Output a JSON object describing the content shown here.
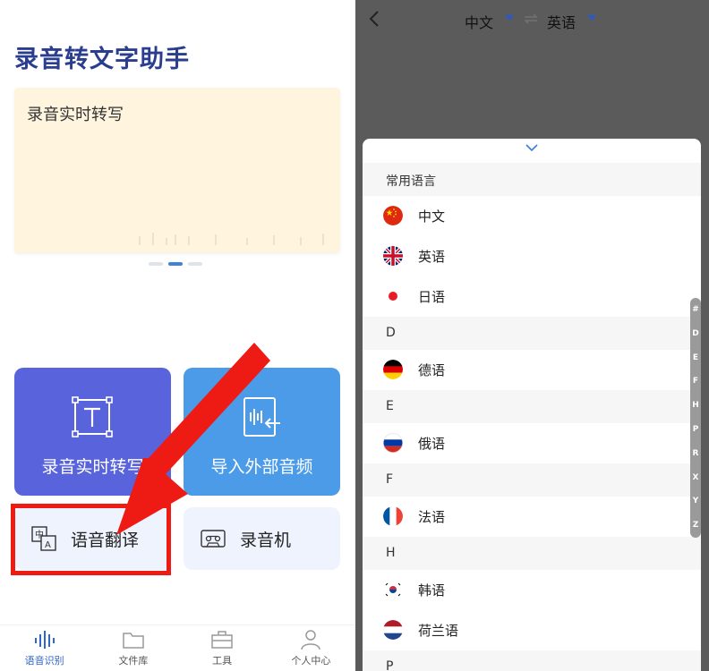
{
  "left": {
    "app_title": "录音转文字助手",
    "banner_text": "录音实时转写",
    "cards": {
      "transcribe": "录音实时转写",
      "import_audio": "导入外部音频"
    },
    "tiles": {
      "translate": "语音翻译",
      "recorder": "录音机"
    },
    "nav": [
      {
        "label": "语音识别",
        "icon": "waveform-icon"
      },
      {
        "label": "文件库",
        "icon": "folder-icon"
      },
      {
        "label": "工具",
        "icon": "toolbox-icon"
      },
      {
        "label": "个人中心",
        "icon": "person-icon"
      }
    ],
    "colors": {
      "title": "#2b3d8f",
      "card_transcribe": "#5963db",
      "card_import": "#4b9be9",
      "highlight": "#ee1b14",
      "nav_active": "#3066c9"
    }
  },
  "right": {
    "source_lang": "中文",
    "target_lang": "英语",
    "sections": [
      {
        "header": "常用语言",
        "items": [
          {
            "label": "中文",
            "flag": "china-flag-icon"
          },
          {
            "label": "英语",
            "flag": "uk-flag-icon"
          },
          {
            "label": "日语",
            "flag": "japan-flag-icon"
          }
        ]
      },
      {
        "header": "D",
        "items": [
          {
            "label": "德语",
            "flag": "germany-flag-icon"
          }
        ]
      },
      {
        "header": "E",
        "items": [
          {
            "label": "俄语",
            "flag": "russia-flag-icon"
          }
        ]
      },
      {
        "header": "F",
        "items": [
          {
            "label": "法语",
            "flag": "france-flag-icon"
          }
        ]
      },
      {
        "header": "H",
        "items": [
          {
            "label": "韩语",
            "flag": "korea-flag-icon"
          },
          {
            "label": "荷兰语",
            "flag": "netherlands-flag-icon"
          }
        ]
      },
      {
        "header": "P",
        "items": []
      }
    ],
    "alpha_index": [
      "#",
      "D",
      "E",
      "F",
      "H",
      "P",
      "R",
      "X",
      "Y",
      "Z"
    ]
  }
}
